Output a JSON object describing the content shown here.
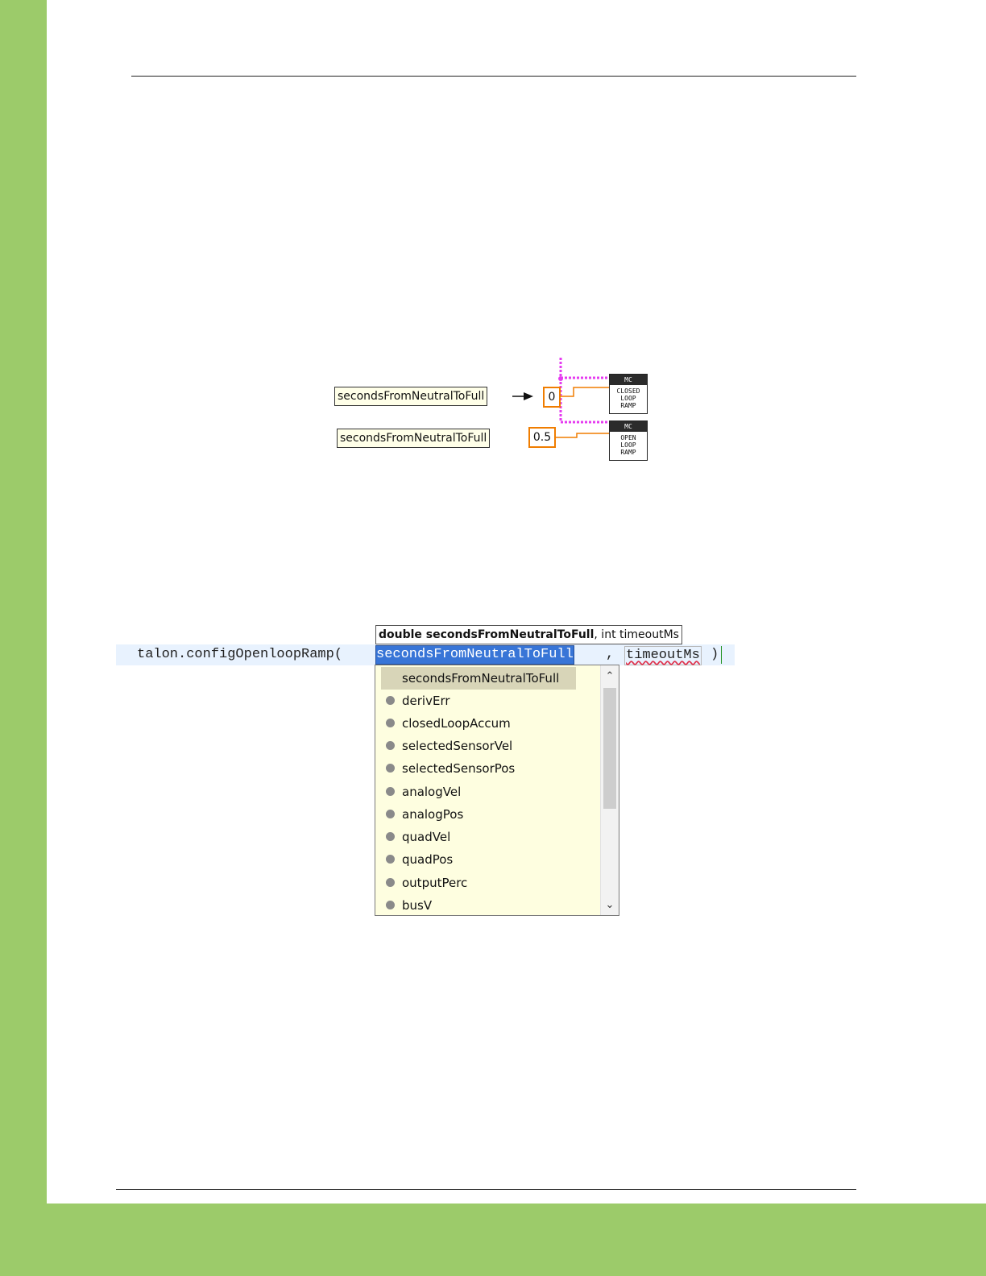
{
  "labview": {
    "label_top": "secondsFromNeutralToFull",
    "label_bottom": "secondsFromNeutralToFull",
    "const_closed": "0",
    "const_open": "0.5",
    "block_closed": {
      "head": "MC",
      "l1": "CLOSED",
      "l2": "LOOP",
      "l3": "RAMP"
    },
    "block_open": {
      "head": "MC",
      "l1": "OPEN",
      "l2": "LOOP",
      "l3": "RAMP"
    },
    "colors": {
      "wire_pink": "#e63cf0",
      "wire_orange": "#f07d00"
    }
  },
  "editor": {
    "call_prefix": "talon.configOpenloopRamp(",
    "param_selected": "secondsFromNeutralToFull",
    "comma": ",",
    "param_second": "timeoutMs",
    "close_paren": ")"
  },
  "tooltip": {
    "bold_part": "double secondsFromNeutralToFull",
    "rest_part": ", int timeoutMs"
  },
  "autocomplete": {
    "items": [
      "secondsFromNeutralToFull",
      "derivErr",
      "closedLoopAccum",
      "selectedSensorVel",
      "selectedSensorPos",
      "analogVel",
      "analogPos",
      "quadVel",
      "quadPos",
      "outputPerc",
      "busV"
    ]
  },
  "colors": {
    "page_green": "#9ccb6a",
    "selection_blue": "#3875d7",
    "popup_bg": "#fefee0"
  }
}
